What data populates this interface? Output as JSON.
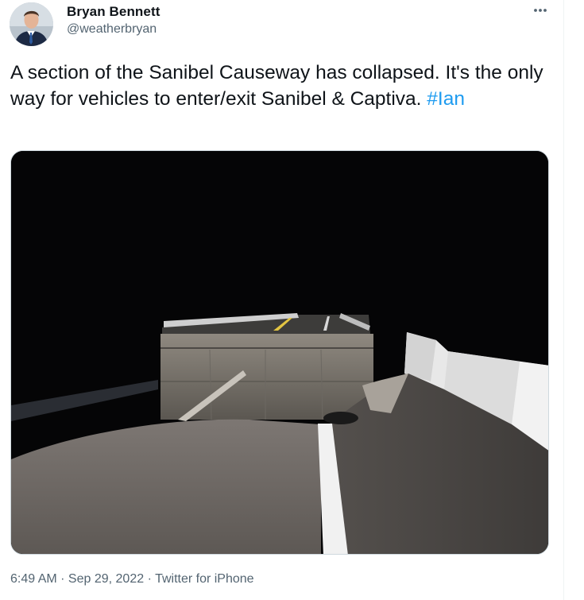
{
  "author": {
    "display_name": "Bryan Bennett",
    "handle": "@weatherbryan"
  },
  "more_icon": "more-horizontal-icon",
  "tweet": {
    "text_before": "A section of the Sanibel Causeway has collapsed.  It's the only way for vehicles to enter/exit Sanibel & Captiva. ",
    "hashtag": "#Ian"
  },
  "meta": {
    "time": "6:49 AM",
    "separator": " · ",
    "date": "Sep 29, 2022",
    "source": "Twitter for iPhone"
  },
  "colors": {
    "link": "#1d9bf0",
    "secondary_text": "#536471",
    "primary_text": "#0f1419"
  }
}
